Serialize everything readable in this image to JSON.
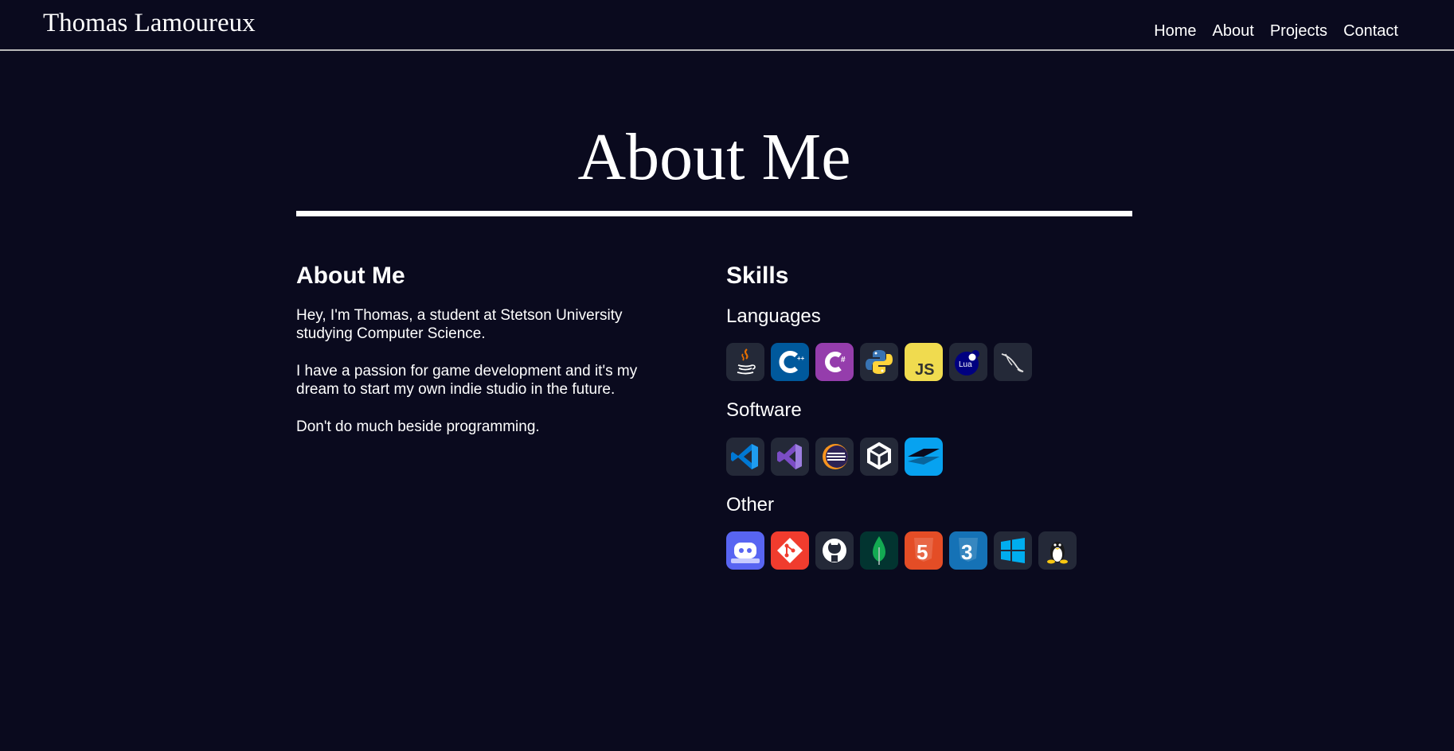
{
  "header": {
    "brand": "Thomas Lamoureux",
    "nav": [
      "Home",
      "About",
      "Projects",
      "Contact"
    ]
  },
  "hero": {
    "title": "About Me"
  },
  "about": {
    "heading": "About Me",
    "paragraphs": [
      "Hey, I'm Thomas, a student at Stetson University studying Computer Science.",
      "I have a passion for game development and it's my dream to start my own indie studio in the future.",
      "Don't do much beside programming."
    ]
  },
  "skills": {
    "heading": "Skills",
    "groups": [
      {
        "title": "Languages",
        "icons": [
          "java-icon",
          "cpp-icon",
          "csharp-icon",
          "python-icon",
          "javascript-icon",
          "lua-icon",
          "mysql-icon"
        ]
      },
      {
        "title": "Software",
        "icons": [
          "vscode-icon",
          "visual-studio-icon",
          "eclipse-icon",
          "unity-icon",
          "webstorm-icon"
        ]
      },
      {
        "title": "Other",
        "icons": [
          "discord-bot-icon",
          "git-icon",
          "github-icon",
          "mongodb-icon",
          "html5-icon",
          "css3-icon",
          "windows-icon",
          "linux-icon"
        ]
      }
    ]
  },
  "colors": {
    "background": "#0a0a1e",
    "text": "#ffffff",
    "icon_tile": "#242938"
  }
}
